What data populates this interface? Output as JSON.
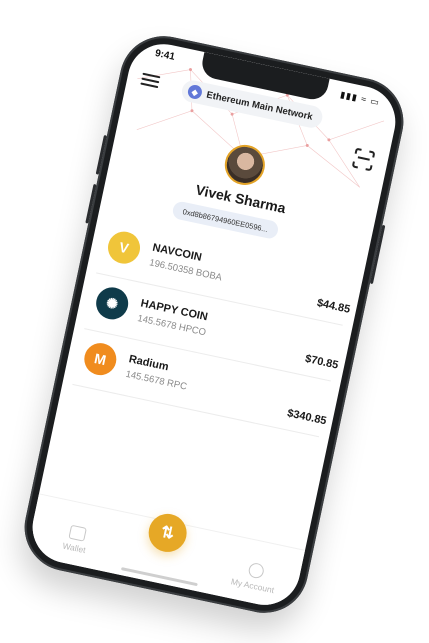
{
  "status_bar": {
    "time": "9:41",
    "indicators": "▮▮▮ ≈ ▭"
  },
  "header": {
    "menu_icon": "hamburger-icon",
    "network_label": "Ethereum Main Network",
    "network_icon": "ethereum-icon",
    "scan_icon": "qr-scan-icon"
  },
  "profile": {
    "name": "Vivek Sharma",
    "address": "0xd8b86794960EE0596..."
  },
  "tokens": [
    {
      "name": "NAVCOIN",
      "balance": "196.50358 BOBA",
      "usd": "$44.85",
      "icon": "navcoin-icon",
      "color": "#f0c53a",
      "glyph": "V"
    },
    {
      "name": "HAPPY COIN",
      "balance": "145.5678 HPCO",
      "usd": "$70.85",
      "icon": "happy-coin-icon",
      "color": "#0f3b4a",
      "glyph": "✺"
    },
    {
      "name": "Radium",
      "balance": "145.5678 RPC",
      "usd": "$340.85",
      "icon": "radium-icon",
      "color": "#f08c1e",
      "glyph": "M"
    }
  ],
  "bottom_nav": {
    "wallet_label": "Wallet",
    "account_label": "My Account",
    "swap_glyph": "⇅"
  },
  "colors": {
    "accent": "#e6a826",
    "pill_bg": "#e9eef7",
    "frame": "#1b1d1f"
  }
}
